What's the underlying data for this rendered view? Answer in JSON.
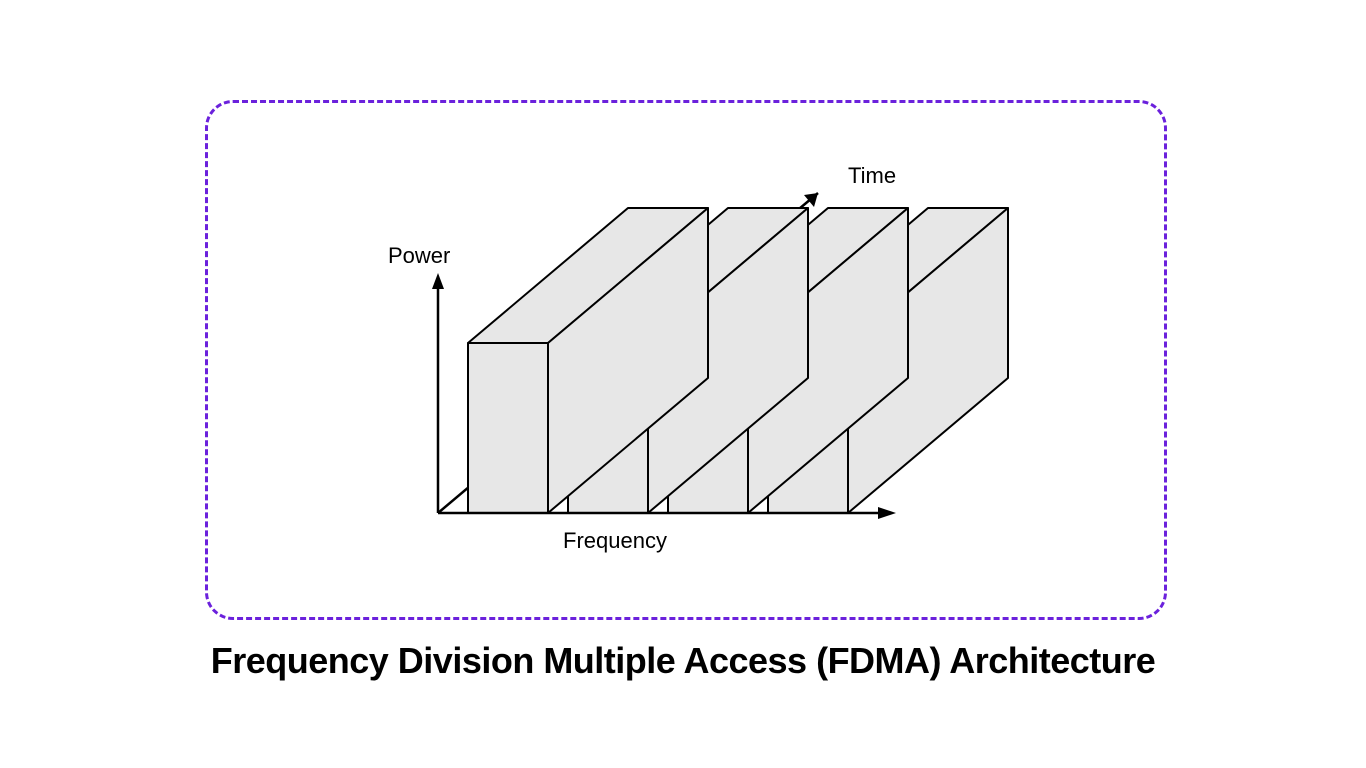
{
  "diagram": {
    "caption": "Frequency Division Multiple Access (FDMA) Architecture",
    "axes": {
      "vertical_label": "Power",
      "horizontal_label": "Frequency",
      "depth_label": "Time"
    },
    "blocks": {
      "count": 4,
      "description": "Four parallel 3D slabs side-by-side along the Frequency axis, extending in Time, with uniform height in Power.",
      "fill_color": "#E7E7E7",
      "stroke_color": "#000000"
    },
    "frame": {
      "border_style": "dashed",
      "border_color": "#6B21DC",
      "border_radius_px": 28
    }
  }
}
